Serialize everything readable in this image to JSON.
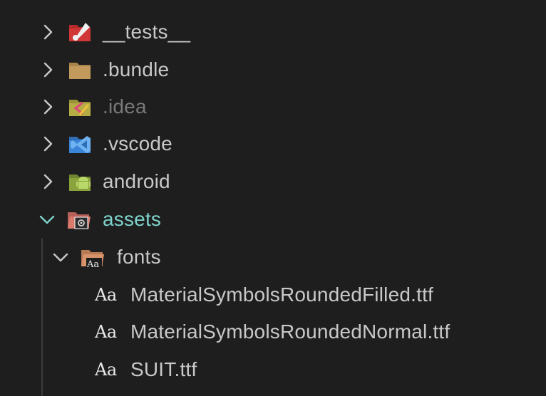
{
  "explorer": {
    "items": [
      {
        "label": "__tests__",
        "expanded": false,
        "icon": "tests-folder-icon",
        "color": "#c62f2f"
      },
      {
        "label": ".bundle",
        "expanded": false,
        "icon": "folder-icon",
        "color": "#c09553"
      },
      {
        "label": ".idea",
        "expanded": false,
        "icon": "idea-folder-icon",
        "color": "#b5a642",
        "dimmed": true
      },
      {
        "label": ".vscode",
        "expanded": false,
        "icon": "vscode-folder-icon",
        "color": "#3a85d8"
      },
      {
        "label": "android",
        "expanded": false,
        "icon": "android-folder-icon",
        "color": "#8aa33c"
      },
      {
        "label": "assets",
        "expanded": true,
        "icon": "assets-folder-icon",
        "color": "#d97a6d"
      },
      {
        "label": "fonts",
        "expanded": true,
        "icon": "fonts-folder-icon",
        "color": "#d9936b"
      },
      {
        "label": "MaterialSymbolsRoundedFilled.ttf",
        "icon": "font-file-icon"
      },
      {
        "label": "MaterialSymbolsRoundedNormal.ttf",
        "icon": "font-file-icon"
      },
      {
        "label": "SUIT.ttf",
        "icon": "font-file-icon"
      }
    ],
    "font_icon_glyph": "Aa"
  }
}
